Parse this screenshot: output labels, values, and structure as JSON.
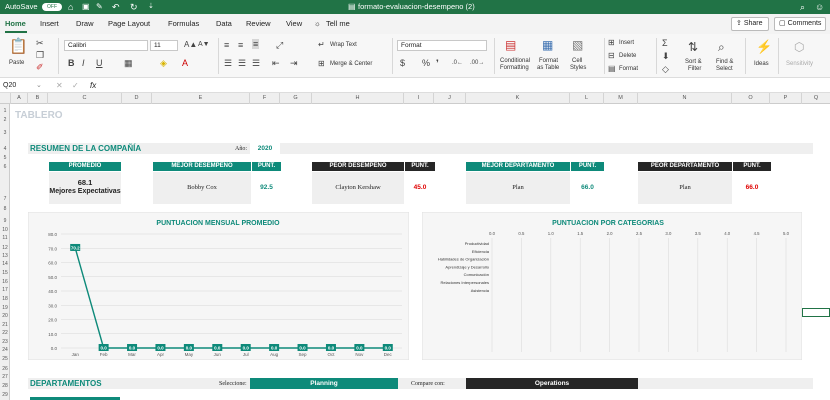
{
  "window": {
    "autosave": "AutoSave",
    "autosave_state": "OFF",
    "title": "formato-evaluacion-desempeno (2)"
  },
  "tabs": [
    "Home",
    "Insert",
    "Draw",
    "Page Layout",
    "Formulas",
    "Data",
    "Review",
    "View"
  ],
  "tell_me": "Tell me",
  "share": "Share",
  "comments": "Comments",
  "ribbon": {
    "paste": "Paste",
    "font": "Calibri",
    "size": "11",
    "format": "Format",
    "wrap": "Wrap Text",
    "merge": "Merge & Center",
    "cond": "Conditional",
    "cond2": "Formatting",
    "fmt_table": "Format",
    "fmt_table2": "as Table",
    "cell_styles": "Cell",
    "cell_styles2": "Styles",
    "insert": "Insert",
    "delete": "Delete",
    "sort": "Sort &",
    "sort2": "Filter",
    "find": "Find &",
    "find2": "Select",
    "ideas": "Ideas",
    "sens": "Sensitivity"
  },
  "formula": {
    "cell_ref": "Q20",
    "fx": "fx"
  },
  "columns": [
    "A",
    "B",
    "C",
    "D",
    "E",
    "F",
    "G",
    "H",
    "I",
    "J",
    "K",
    "L",
    "M",
    "N",
    "O",
    "P",
    "Q"
  ],
  "rows": [
    "1",
    "2",
    "3",
    "4",
    "5",
    "6",
    "7",
    "8",
    "9",
    "10",
    "11",
    "12",
    "13",
    "14",
    "15",
    "16",
    "17",
    "18",
    "19",
    "20",
    "21",
    "22",
    "23",
    "24",
    "25",
    "26",
    "27",
    "28",
    "29"
  ],
  "sheet": {
    "tablero": "TABLERO",
    "resumen": "RESUMEN DE LA COMPAÑÍA",
    "ano_label": "Año:",
    "ano": "2020",
    "promedio_h": "PROMEDIO",
    "promedio_v": "68.1",
    "promedio_t": "Mejores Expectativas",
    "mejor_des_h": "MEJOR DESEMPEÑO",
    "mejor_des_n": "Bobby Cox",
    "punt_h": "PUNT.",
    "mejor_des_p": "92.5",
    "peor_des_h": "PEOR DESEMPEÑO",
    "peor_des_n": "Clayton Kershaw",
    "peor_des_p": "45.0",
    "mejor_dep_h": "MEJOR DEPARTAMENTO",
    "mejor_dep_n": "Plan",
    "mejor_dep_p": "66.0",
    "peor_dep_h": "PEOR DEPARTAMENTO",
    "peor_dep_n": "Plan",
    "peor_dep_p": "66.0",
    "departamentos": "DEPARTAMENTOS",
    "seleccione": "Seleccione:",
    "sel_val": "Planning",
    "compare": "Compare con:",
    "comp_val": "Operations"
  },
  "colors": {
    "teal": "#0e8a7a",
    "dark": "#262626",
    "green": "#217346",
    "red": "#e00000"
  },
  "chart_data": [
    {
      "type": "line",
      "title": "PUNTUACION MENSUAL PROMEDIO",
      "categories": [
        "Jan",
        "Feb",
        "Mar",
        "Apr",
        "May",
        "Jun",
        "Jul",
        "Aug",
        "Sep",
        "Oct",
        "Nov",
        "Dec"
      ],
      "values": [
        70.2,
        0.0,
        0.0,
        0.0,
        0.0,
        0.0,
        0.0,
        0.0,
        0.0,
        0.0,
        0.0,
        0.0
      ],
      "labels": [
        "70.2",
        "0.0",
        "0.0",
        "0.0",
        "0.0",
        "0.0",
        "0.0",
        "0.0",
        "0.0",
        "0.0",
        "0.0",
        "0.0"
      ],
      "ylim": [
        0,
        80
      ],
      "yticks": [
        "0.0",
        "10.0",
        "20.0",
        "30.0",
        "40.0",
        "50.0",
        "60.0",
        "70.0",
        "80.0"
      ],
      "grid": true
    },
    {
      "type": "bar",
      "title": "PUNTUACION POR CATEGORIAS",
      "categories": [
        "Productividad",
        "Eficiencia",
        "Habilidades de Organización",
        "Aprendizaje y Desarrollo",
        "Comunicación",
        "Relaciones Interpersonales",
        "Asistencia"
      ],
      "values": [
        0,
        0,
        0,
        0,
        0,
        0,
        0
      ],
      "xlim": [
        0,
        5
      ],
      "xticks": [
        "0.0",
        "0.5",
        "1.0",
        "1.5",
        "2.0",
        "2.5",
        "3.0",
        "3.5",
        "4.0",
        "4.5",
        "5.0"
      ],
      "grid": true
    }
  ]
}
